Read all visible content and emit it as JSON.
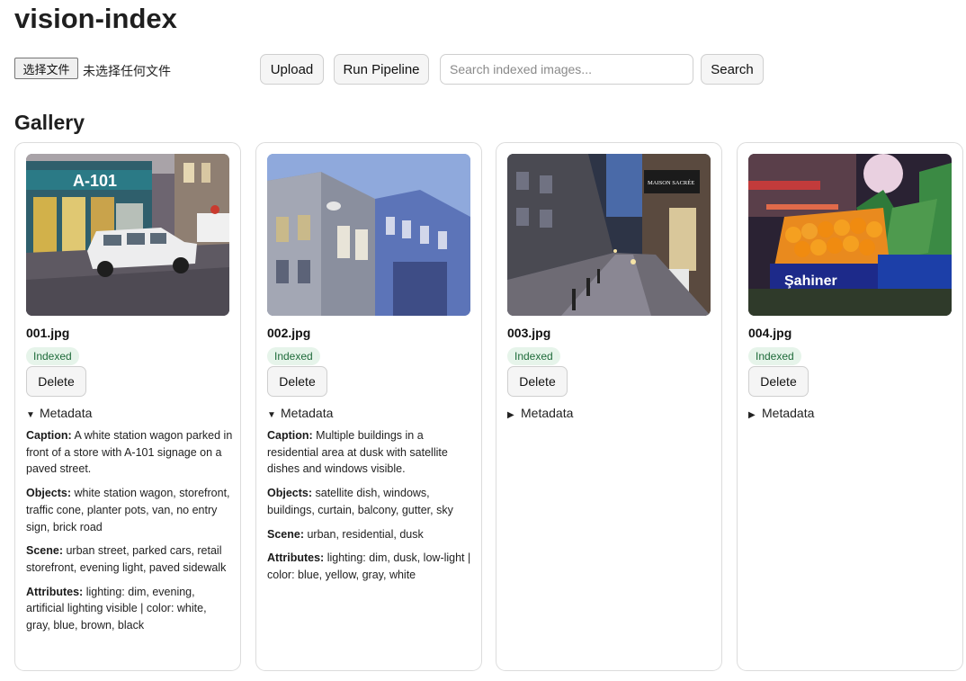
{
  "app": {
    "title": "vision-index"
  },
  "toolbar": {
    "file_button_label": "选择文件",
    "file_status": "未选择任何文件",
    "upload_label": "Upload",
    "run_pipeline_label": "Run Pipeline",
    "search_placeholder": "Search indexed images...",
    "search_value": "",
    "search_label": "Search"
  },
  "gallery": {
    "title": "Gallery",
    "items": [
      {
        "filename": "001.jpg",
        "status": "Indexed",
        "delete_label": "Delete",
        "metadata_label": "Metadata",
        "expanded": true,
        "caption_label": "Caption:",
        "caption": "A white station wagon parked in front of a store with A-101 signage on a paved street.",
        "objects_label": "Objects:",
        "objects": "white station wagon, storefront, traffic cone, planter pots, van, no entry sign, brick road",
        "scene_label": "Scene:",
        "scene": "urban street, parked cars, retail storefront, evening light, paved sidewalk",
        "attributes_label": "Attributes:",
        "attributes": "lighting: dim, evening, artificial lighting visible | color: white, gray, blue, brown, black",
        "image_text": "A-101"
      },
      {
        "filename": "002.jpg",
        "status": "Indexed",
        "delete_label": "Delete",
        "metadata_label": "Metadata",
        "expanded": true,
        "caption_label": "Caption:",
        "caption": "Multiple buildings in a residential area at dusk with satellite dishes and windows visible.",
        "objects_label": "Objects:",
        "objects": "satellite dish, windows, buildings, curtain, balcony, gutter, sky",
        "scene_label": "Scene:",
        "scene": "urban, residential, dusk",
        "attributes_label": "Attributes:",
        "attributes": "lighting: dim, dusk, low-light | color: blue, yellow, gray, white"
      },
      {
        "filename": "003.jpg",
        "status": "Indexed",
        "delete_label": "Delete",
        "metadata_label": "Metadata",
        "expanded": false,
        "image_text": "MAISON SACRÉE"
      },
      {
        "filename": "004.jpg",
        "status": "Indexed",
        "delete_label": "Delete",
        "metadata_label": "Metadata",
        "expanded": false,
        "image_text": "Şahiner"
      }
    ]
  },
  "colors": {
    "badge_bg": "#e6f4ea",
    "badge_text": "#1e6b3a",
    "button_bg": "#f5f5f5",
    "border": "#dcdcdc"
  }
}
